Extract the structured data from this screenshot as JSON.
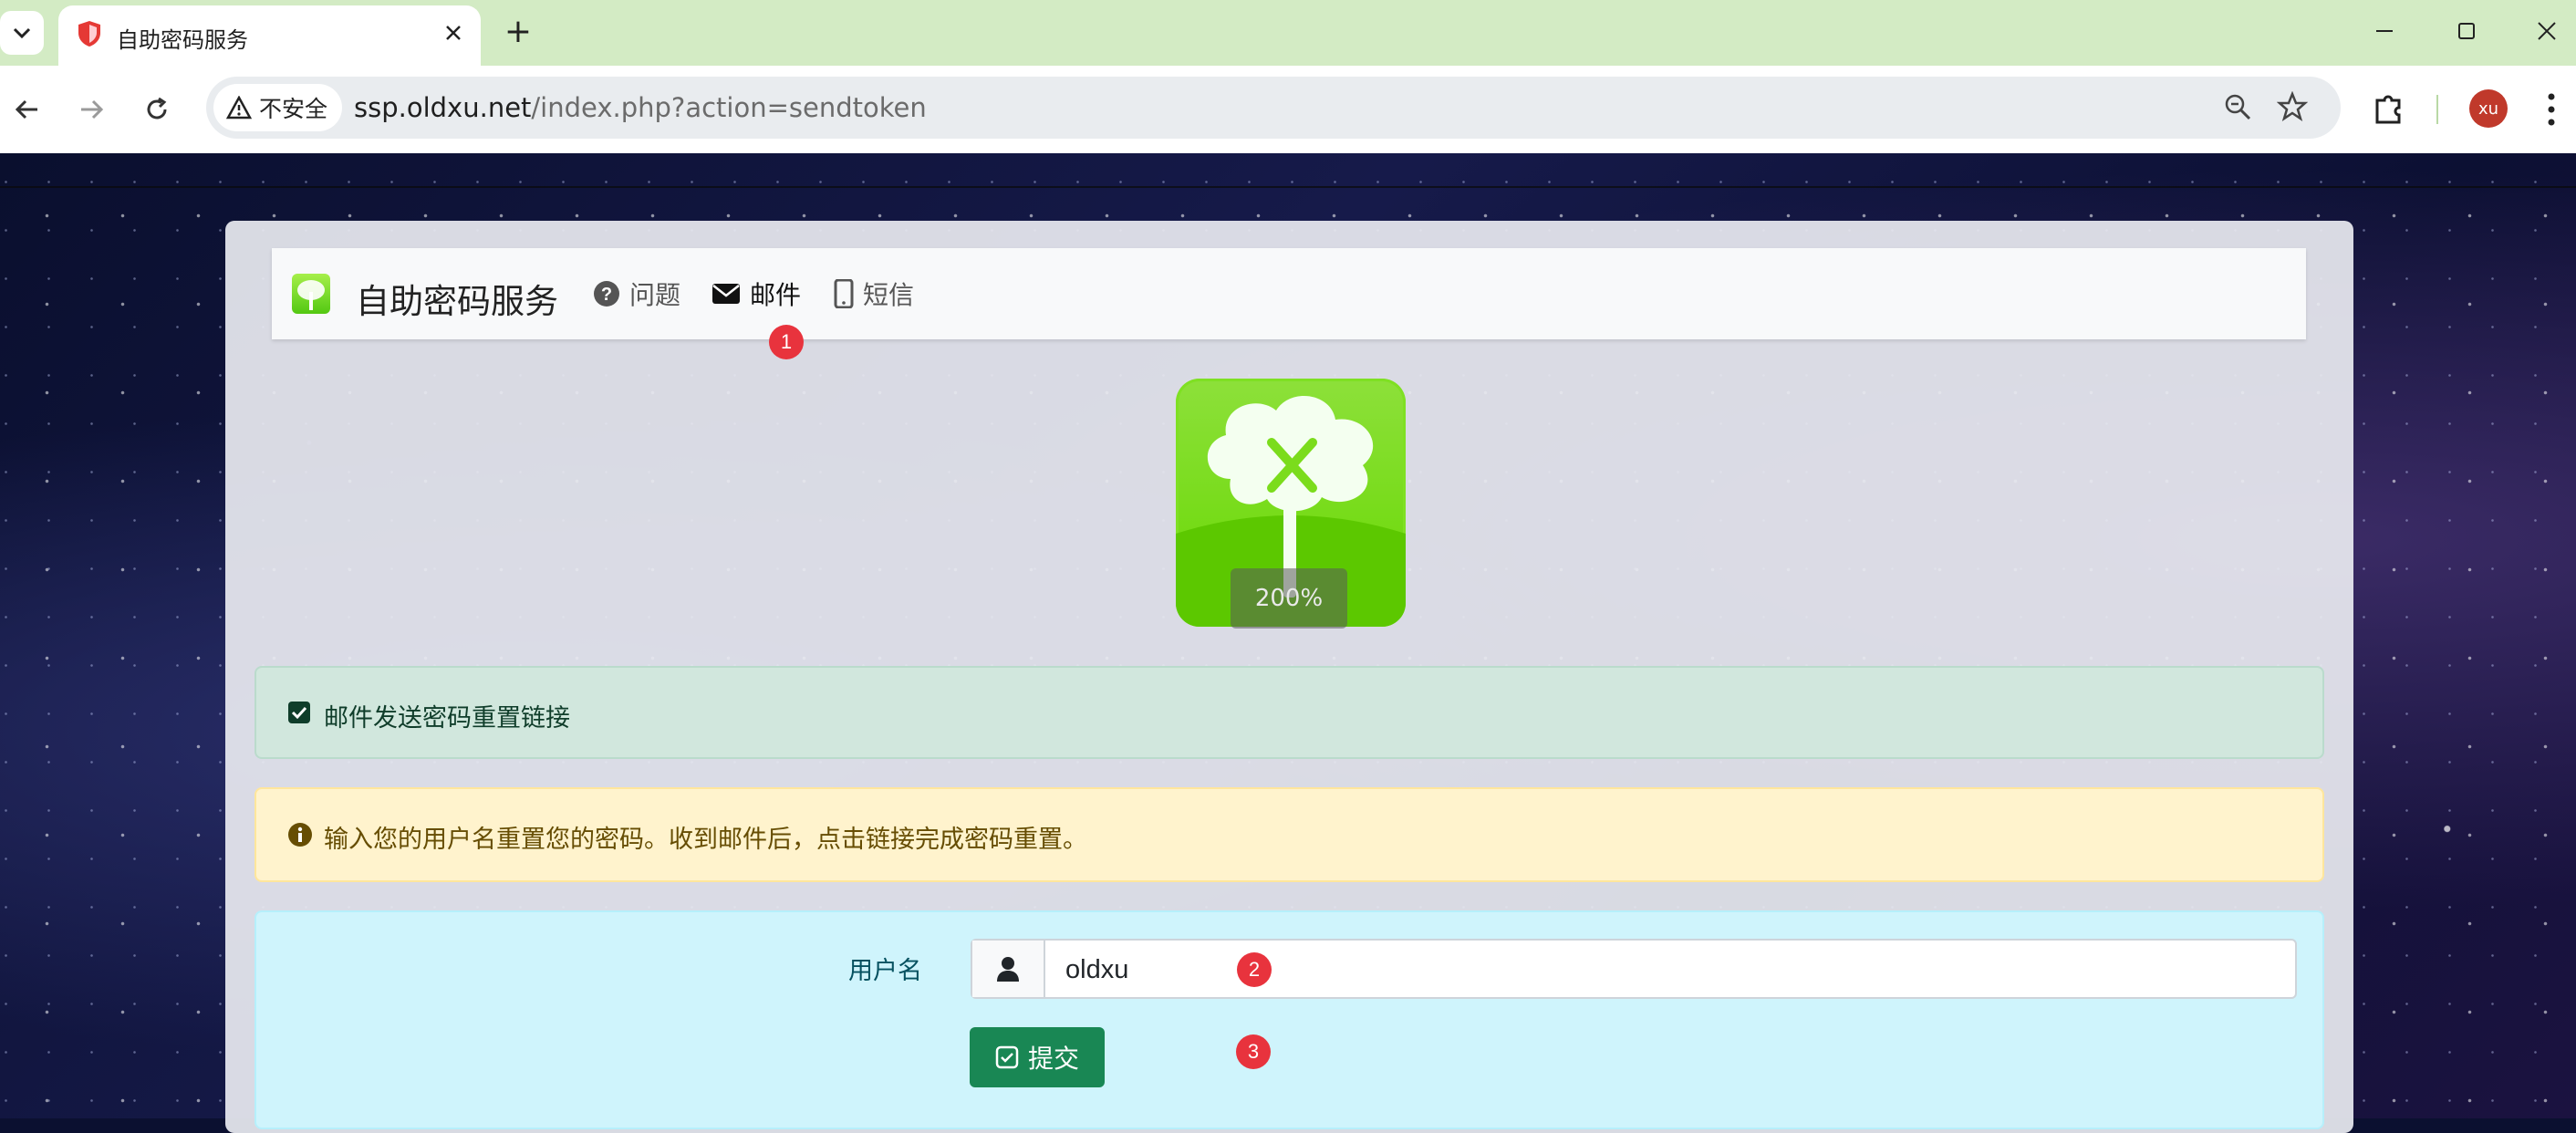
{
  "browser": {
    "tab_title": "自助密码服务",
    "new_tab_symbol": "+",
    "security_label": "不安全",
    "url_host": "ssp.oldxu.net",
    "url_path": "/index.php?action=sendtoken",
    "profile_initials": "xu"
  },
  "navbar": {
    "brand": "自助密码服务",
    "links": [
      {
        "label": "问题",
        "icon": "question-circle-icon"
      },
      {
        "label": "邮件",
        "icon": "envelope-icon"
      },
      {
        "label": "短信",
        "icon": "mobile-phone-icon"
      }
    ]
  },
  "logo": {
    "zoom_text": "200%"
  },
  "alerts": {
    "success": "邮件发送密码重置链接",
    "warning": "输入您的用户名重置您的密码。收到邮件后，点击链接完成密码重置。"
  },
  "form": {
    "username_label": "用户名",
    "username_value": "oldxu",
    "submit_label": "提交"
  },
  "annotations": [
    "1",
    "2",
    "3"
  ],
  "colors": {
    "tabstrip": "#d3ebc4",
    "success_bg": "#d1e7dd",
    "warning_bg": "#fff3cd",
    "info_bg": "#cff4fc",
    "submit_bg": "#198754",
    "badge": "#e8333d",
    "logo_green": "#66d800"
  }
}
